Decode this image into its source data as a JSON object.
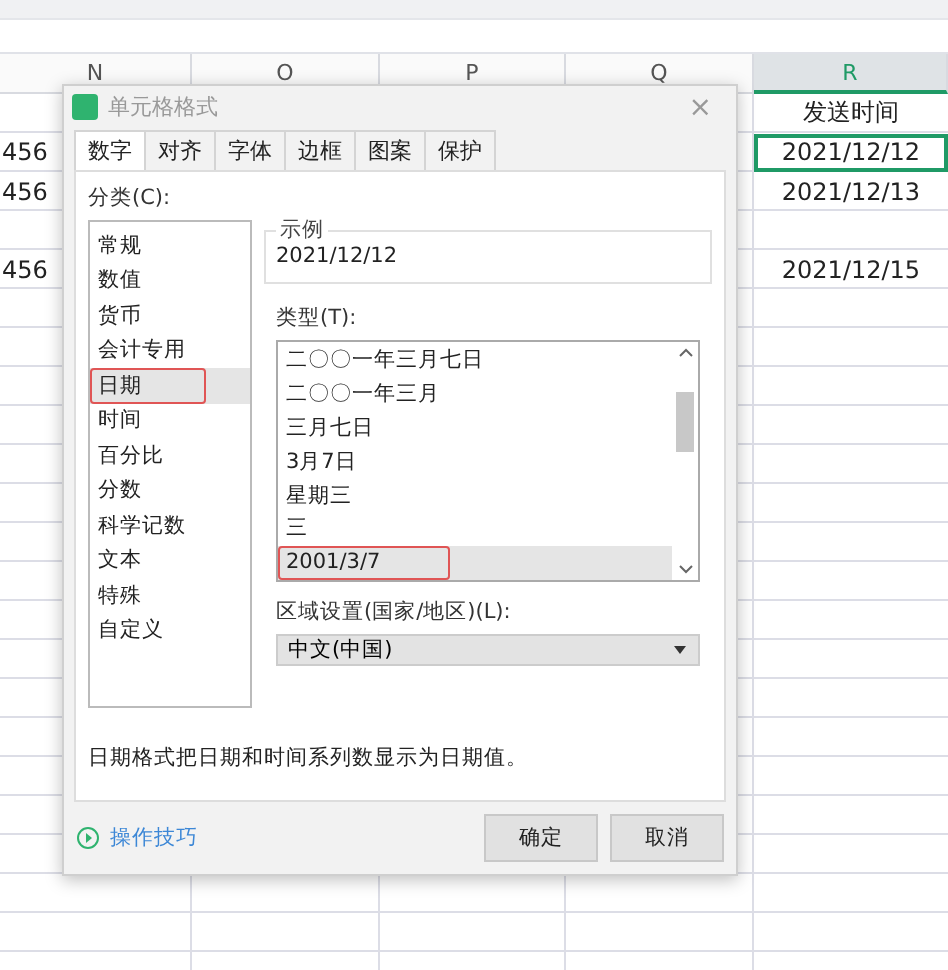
{
  "sheet": {
    "columns": [
      {
        "label": "N",
        "selected": false
      },
      {
        "label": "O",
        "selected": false
      },
      {
        "label": "P",
        "selected": false
      },
      {
        "label": "Q",
        "selected": false
      },
      {
        "label": "R",
        "selected": true
      }
    ],
    "rows": [
      {
        "cells": [
          null,
          null,
          null,
          null,
          {
            "text": "发送时间",
            "selected": false
          }
        ]
      },
      {
        "cells": [
          {
            "text": "456",
            "selected": false
          },
          null,
          null,
          null,
          {
            "text": "2021/12/12",
            "selected": true
          }
        ]
      },
      {
        "cells": [
          {
            "text": "456",
            "selected": false
          },
          null,
          null,
          null,
          {
            "text": "2021/12/13",
            "selected": false
          }
        ]
      },
      {
        "cells": [
          null,
          null,
          null,
          null,
          null
        ]
      },
      {
        "cells": [
          {
            "text": "456",
            "selected": false
          },
          null,
          null,
          null,
          {
            "text": "2021/12/15",
            "selected": false
          }
        ]
      }
    ]
  },
  "dialog": {
    "title": "单元格格式",
    "close": "×",
    "tabs": [
      {
        "label": "数字",
        "selected": true
      },
      {
        "label": "对齐",
        "selected": false
      },
      {
        "label": "字体",
        "selected": false
      },
      {
        "label": "边框",
        "selected": false
      },
      {
        "label": "图案",
        "selected": false
      },
      {
        "label": "保护",
        "selected": false
      }
    ],
    "category_label": "分类(C):",
    "categories": [
      {
        "label": "常规",
        "selected": false,
        "highlighted": false
      },
      {
        "label": "数值",
        "selected": false,
        "highlighted": false
      },
      {
        "label": "货币",
        "selected": false,
        "highlighted": false
      },
      {
        "label": "会计专用",
        "selected": false,
        "highlighted": false
      },
      {
        "label": "日期",
        "selected": true,
        "highlighted": true
      },
      {
        "label": "时间",
        "selected": false,
        "highlighted": false
      },
      {
        "label": "百分比",
        "selected": false,
        "highlighted": false
      },
      {
        "label": "分数",
        "selected": false,
        "highlighted": false
      },
      {
        "label": "科学记数",
        "selected": false,
        "highlighted": false
      },
      {
        "label": "文本",
        "selected": false,
        "highlighted": false
      },
      {
        "label": "特殊",
        "selected": false,
        "highlighted": false
      },
      {
        "label": "自定义",
        "selected": false,
        "highlighted": false
      }
    ],
    "sample": {
      "legend": "示例",
      "value": "2021/12/12"
    },
    "type_label": "类型(T):",
    "types": [
      {
        "label": "二〇〇一年三月七日",
        "selected": false,
        "highlighted": false
      },
      {
        "label": "二〇〇一年三月",
        "selected": false,
        "highlighted": false
      },
      {
        "label": "三月七日",
        "selected": false,
        "highlighted": false
      },
      {
        "label": "3月7日",
        "selected": false,
        "highlighted": false
      },
      {
        "label": "星期三",
        "selected": false,
        "highlighted": false
      },
      {
        "label": "三",
        "selected": false,
        "highlighted": false
      },
      {
        "label": "2001/3/7",
        "selected": true,
        "highlighted": true
      }
    ],
    "locale_label": "区域设置(国家/地区)(L):",
    "locale_value": "中文(中国)",
    "description": "日期格式把日期和时间系列数显示为日期值。",
    "tips_link": "操作技巧",
    "buttons": [
      "确定",
      "取消"
    ]
  }
}
